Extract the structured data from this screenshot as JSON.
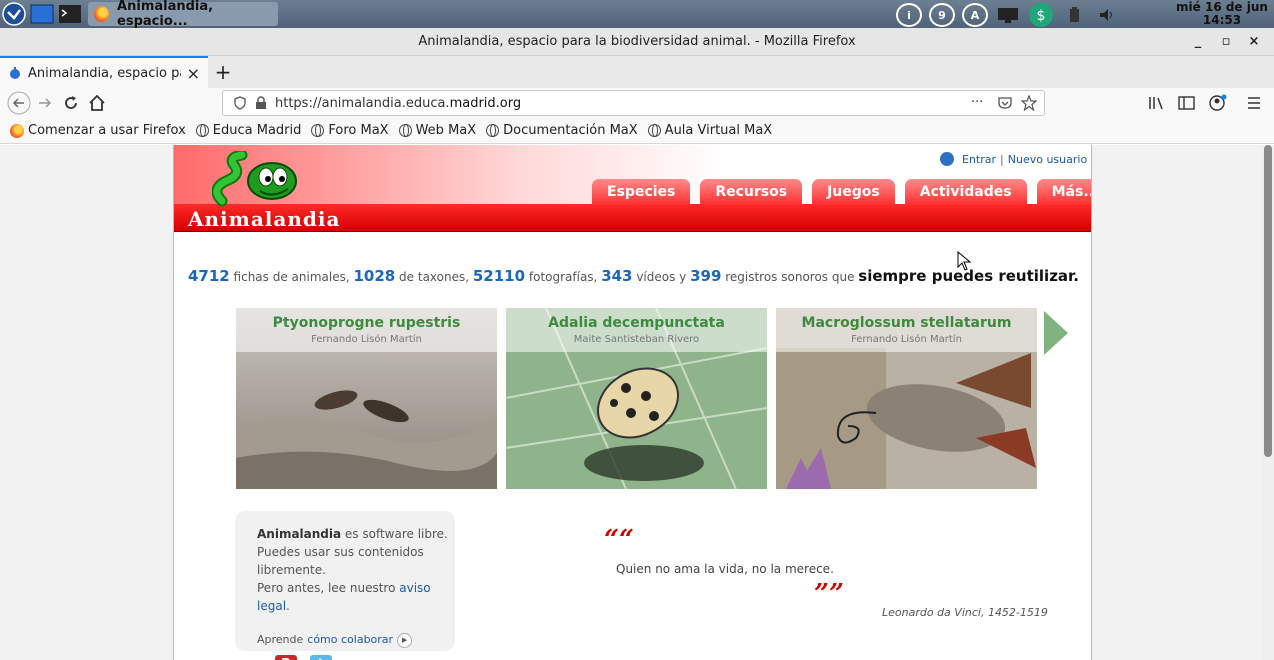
{
  "taskbar": {
    "task_title": "Animalandia, espacio...",
    "clock_date": "mié 16 de jun",
    "clock_time": "14:53",
    "tray_icons": [
      "info-icon",
      "nine-icon",
      "a-icon",
      "screen-icon",
      "sync-icon",
      "battery-icon",
      "volume-icon"
    ]
  },
  "window": {
    "title": "Animalandia, espacio para la biodiversidad animal. - Mozilla Firefox",
    "minimize": "_",
    "maximize": "▫",
    "close": "×"
  },
  "tab": {
    "title": "Animalandia, espacio para",
    "close": "×",
    "new_tab": "+"
  },
  "urlbar": {
    "prefix": "https://animalandia.educa.",
    "host": "madrid.org",
    "more": "···"
  },
  "bookmarks": [
    "Comenzar a usar Firefox",
    "Educa Madrid",
    "Foro MaX",
    "Web MaX",
    "Documentación MaX",
    "Aula Virtual MaX"
  ],
  "site": {
    "logo": "Animalandia",
    "login": "Entrar",
    "separator": "|",
    "register": "Nuevo usuario",
    "menu": [
      "Especies",
      "Recursos",
      "Juegos",
      "Actividades",
      "Más..."
    ]
  },
  "stats": {
    "fichas": "4712",
    "fichas_label": " fichas de animales, ",
    "taxones": "1028",
    "taxones_label": " de taxones, ",
    "fotos": "52110",
    "fotos_label": " fotografías, ",
    "videos": "343",
    "videos_label": " vídeos y ",
    "sonidos": "399",
    "sonidos_label": " registros sonoros que ",
    "tagline": "siempre puedes reutilizar."
  },
  "slides": [
    {
      "name": "Ptyonoprogne rupestris",
      "author": "Fernando Lisón Martín"
    },
    {
      "name": "Adalia decempunctata",
      "author": "Maite Santisteban Rivero"
    },
    {
      "name": "Macroglossum stellatarum",
      "author": "Fernando Lisón Martín"
    }
  ],
  "info": {
    "brand": "Animalandia",
    "line1": " es software libre.",
    "line2": "Puedes usar sus contenidos libremente.",
    "line3": "Pero antes, lee nuestro ",
    "legal": "aviso legal",
    "dot": ".",
    "collab_prefix": "Aprende ",
    "collab_link": "cómo colaborar",
    "blog": "B",
    "twitter": "t"
  },
  "quote": {
    "open": "““",
    "text": "Quien no ama la vida, no la merece.",
    "close": "””",
    "author": "Leonardo da Vinci, 1452-1519"
  },
  "colors": {
    "accent_red": "#e00000",
    "link_blue": "#1a5ab0",
    "species_green": "#3e8a3e",
    "firefox_blue": "#0a84ff"
  }
}
